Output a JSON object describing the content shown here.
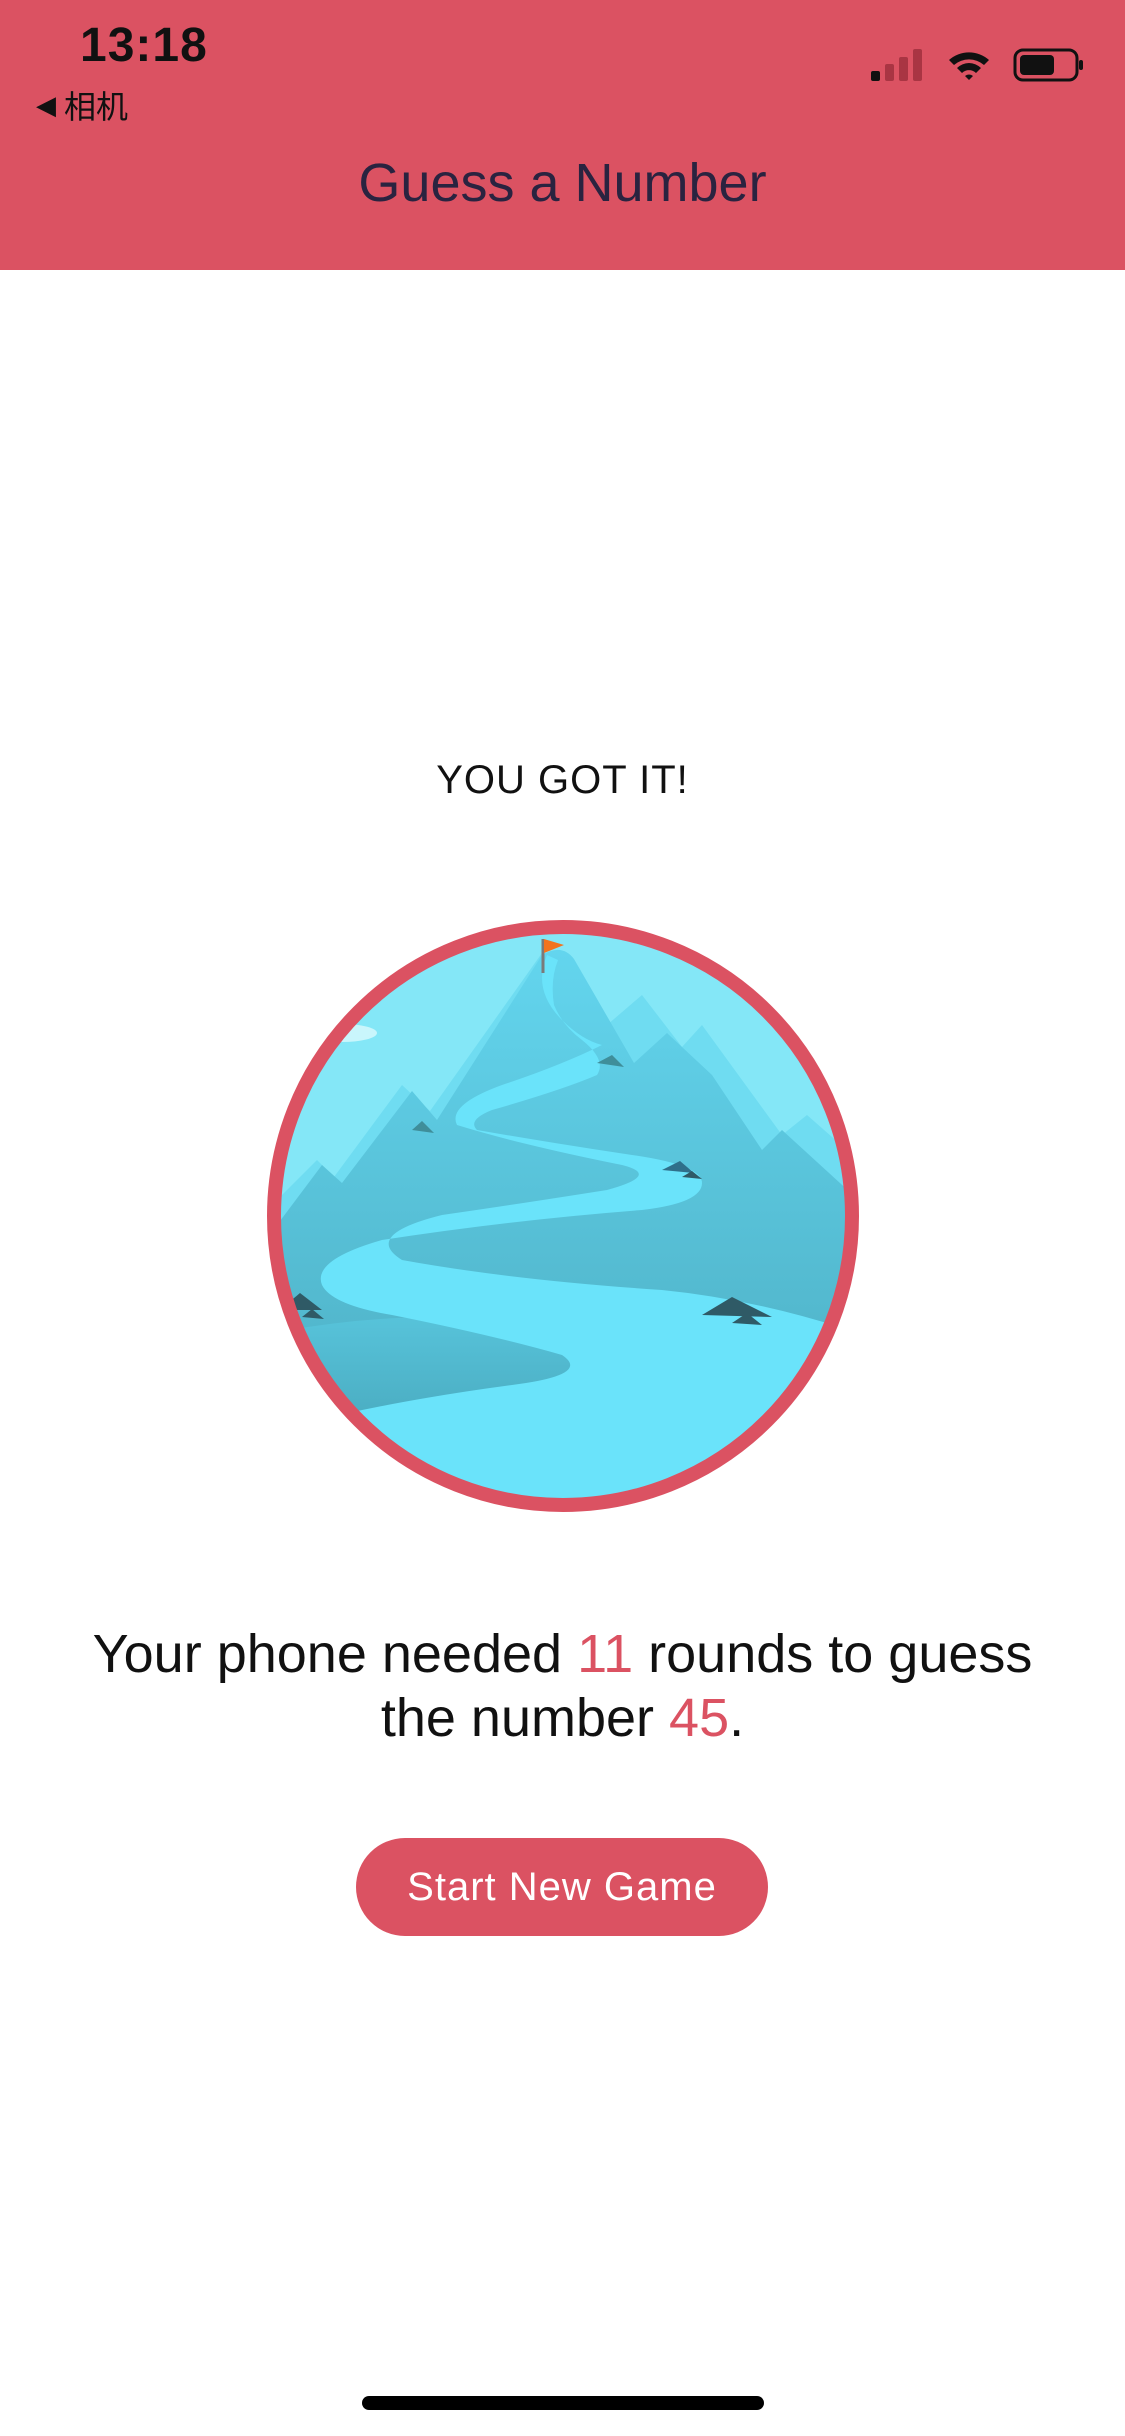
{
  "status_bar": {
    "time": "13:18",
    "back_label": "相机",
    "icons": [
      "cellular-signal-icon",
      "wifi-icon",
      "battery-icon"
    ]
  },
  "nav": {
    "title": "Guess a Number"
  },
  "game_over": {
    "heading": "YOU GOT IT!",
    "illustration": "mountain-summit-flag-icon",
    "result": {
      "prefix": "Your phone needed ",
      "rounds": "11",
      "middle": " rounds to guess the number ",
      "number": "45",
      "suffix": "."
    },
    "restart_label": "Start New Game"
  },
  "colors": {
    "accent": "#db5262",
    "title_text": "#2a2340",
    "body_text": "#111111",
    "sky": "#84e7f7",
    "water": "#66e2fa",
    "mountain": "#5ccde6"
  }
}
